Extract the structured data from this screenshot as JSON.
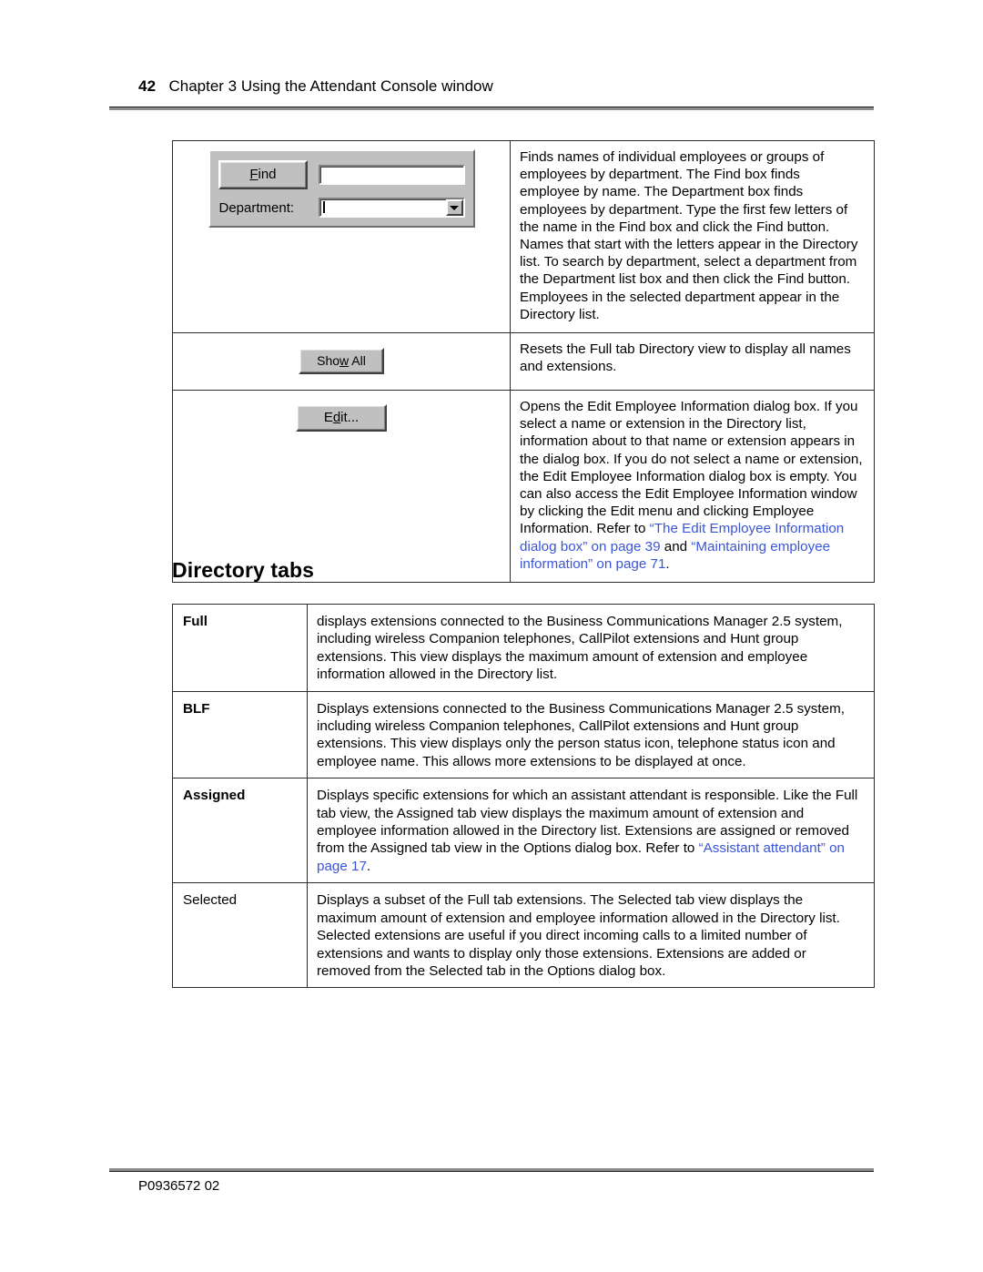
{
  "header": {
    "page_number": "42",
    "chapter": "Chapter 3  Using the Attendant Console window"
  },
  "buttons_table": {
    "rows": [
      {
        "widget": {
          "type": "find-department-panel",
          "find_button_label": "Find",
          "find_button_accel": "F",
          "find_input_value": "",
          "department_label": "Department:",
          "department_value": ""
        },
        "description": "Finds names of individual employees or groups of employees by department. The Find box finds employee by name. The Department box finds employees by department. Type the first few letters of the name in the Find box and click the Find button. Names that start with the letters appear in the Directory list. To search by department, select a department from the Department list box and then click the Find button. Employees in the selected department appear in the Directory list."
      },
      {
        "widget": {
          "type": "show-all-button",
          "label_before": "Sho",
          "label_accel": "w",
          "label_after": " All"
        },
        "description": "Resets the Full tab Directory view to display all names and extensions."
      },
      {
        "widget": {
          "type": "edit-button",
          "label_before": "E",
          "label_accel": "d",
          "label_after": "it..."
        },
        "description_plain": "Opens the Edit Employee Information dialog box. If you select a name or extension in the Directory list, information about to that name or extension appears in the dialog box. If you do not select a name or extension, the Edit Employee Information dialog box is empty. You can also access the Edit Employee Information window by clicking the Edit menu and clicking Employee Information. Refer to ",
        "xref_1": "“The Edit Employee Information dialog box” on page 39",
        "joiner": " and ",
        "xref_2": "“Maintaining employee information” on page 71",
        "tail": "."
      }
    ]
  },
  "section": {
    "heading": "Directory tabs"
  },
  "tabs_table": {
    "rows": [
      {
        "term": "Full",
        "bold": true,
        "definition": "displays extensions connected to the Business Communications Manager 2.5 system, including wireless Companion telephones, CallPilot extensions and Hunt group extensions. This view displays the maximum amount of extension and employee information allowed in the Directory list."
      },
      {
        "term": "BLF",
        "bold": true,
        "definition": "Displays extensions connected to the Business Communications Manager 2.5 system, including wireless Companion telephones, CallPilot extensions and Hunt group extensions. This view displays only the person status icon, telephone status icon and employee name. This allows more extensions to be displayed at once."
      },
      {
        "term": "Assigned",
        "bold": true,
        "definition_plain": "Displays specific extensions for which an assistant attendant is responsible. Like the Full tab view, the Assigned tab view displays the maximum amount of extension and employee information allowed in the Directory list. Extensions are assigned or removed from the Assigned tab view in the Options dialog box. Refer to ",
        "xref_1": "“Assistant attendant” on page 17",
        "tail": "."
      },
      {
        "term": "Selected",
        "bold": false,
        "definition": "Displays a subset of the Full tab extensions. The Selected tab view displays the maximum amount of extension and employee information allowed in the Directory list. Selected extensions are useful if you direct incoming calls to a limited number of extensions and wants to display only those extensions. Extensions are added or removed from the Selected tab in the Options dialog box."
      }
    ]
  },
  "footer": {
    "document_code": "P0936572 02"
  },
  "colors": {
    "xref_link": "#3b55d8",
    "rule": "#8d8d8d",
    "widget_face": "#c0c0c0",
    "table_border": "#2b2b2b"
  }
}
